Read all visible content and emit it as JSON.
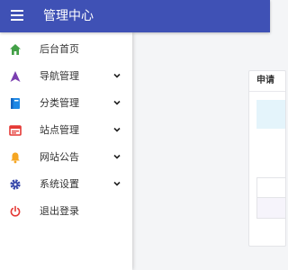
{
  "topbar": {
    "title": "管理中心",
    "menu_icon": "menu-icon",
    "background": "#3f51b5"
  },
  "sidebar": {
    "items": [
      {
        "label": "后台首页",
        "icon": "home-icon",
        "icon_color": "#43a047",
        "has_submenu": false
      },
      {
        "label": "导航管理",
        "icon": "navigation-arrow-icon",
        "icon_color": "#7b3fb0",
        "has_submenu": true
      },
      {
        "label": "分类管理",
        "icon": "book-icon",
        "icon_color": "#1e88e5",
        "has_submenu": true
      },
      {
        "label": "站点管理",
        "icon": "browser-window-icon",
        "icon_color": "#e53935",
        "has_submenu": true
      },
      {
        "label": "网站公告",
        "icon": "bell-icon",
        "icon_color": "#f5a623",
        "has_submenu": true
      },
      {
        "label": "系统设置",
        "icon": "gear-icon",
        "icon_color": "#3949ab",
        "has_submenu": true
      },
      {
        "label": "退出登录",
        "icon": "power-icon",
        "icon_color": "#e53935",
        "has_submenu": false
      }
    ]
  },
  "main": {
    "card_title": "申请"
  }
}
